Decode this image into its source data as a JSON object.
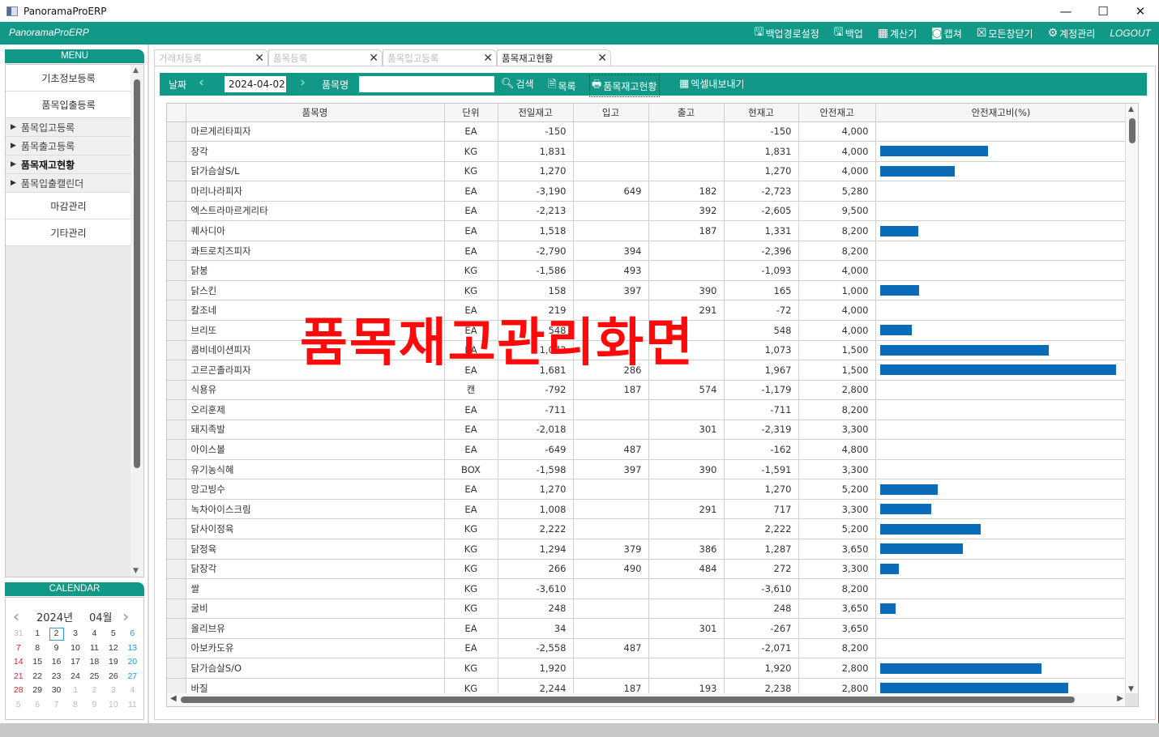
{
  "window": {
    "title": "PanoramaProERP",
    "controls": [
      "—",
      "☐",
      "✕"
    ]
  },
  "appbar": {
    "brand": "PanoramaProERP",
    "actions": [
      {
        "icon": "save-icon",
        "glyph": "🖫",
        "label": "백업경로설정"
      },
      {
        "icon": "save-icon",
        "glyph": "🖫",
        "label": "백업"
      },
      {
        "icon": "calculator-icon",
        "glyph": "▦",
        "label": "계산기"
      },
      {
        "icon": "capture-icon",
        "glyph": "◙",
        "label": "캡쳐"
      },
      {
        "icon": "close-all-icon",
        "glyph": "☒",
        "label": "모든창닫기"
      },
      {
        "icon": "gear-icon",
        "glyph": "⚙",
        "label": "계정관리"
      }
    ],
    "logout": "LOGOUT"
  },
  "sidebar": {
    "menu_title": "MENU",
    "items": [
      {
        "type": "group",
        "label": "기초정보등록"
      },
      {
        "type": "group",
        "label": "품목입출등록"
      },
      {
        "type": "sub",
        "label": "품목입고등록"
      },
      {
        "type": "sub",
        "label": "품목출고등록"
      },
      {
        "type": "sub",
        "label": "품목재고현황",
        "active": true
      },
      {
        "type": "sub",
        "label": "품목입출캘린더"
      },
      {
        "type": "group",
        "label": "마감관리"
      },
      {
        "type": "group",
        "label": "기타관리"
      }
    ],
    "calendar_title": "CALENDAR",
    "calendar": {
      "year": "2024년",
      "month": "04월",
      "selected_day": "2",
      "weeks": [
        [
          "31",
          "1",
          "2",
          "3",
          "4",
          "5",
          "6"
        ],
        [
          "7",
          "8",
          "9",
          "10",
          "11",
          "12",
          "13"
        ],
        [
          "14",
          "15",
          "16",
          "17",
          "18",
          "19",
          "20"
        ],
        [
          "21",
          "22",
          "23",
          "24",
          "25",
          "26",
          "27"
        ],
        [
          "28",
          "29",
          "30",
          "1",
          "2",
          "3",
          "4"
        ],
        [
          "5",
          "6",
          "7",
          "8",
          "9",
          "10",
          "11"
        ]
      ]
    }
  },
  "tabs": [
    {
      "label": "거래처등록",
      "active": false
    },
    {
      "label": "품목등록",
      "active": false
    },
    {
      "label": "품목입고등록",
      "active": false
    },
    {
      "label": "품목재고현황",
      "active": true
    }
  ],
  "toolbar": {
    "date_label": "날짜",
    "date_value": "2024-04-02",
    "item_label": "품목명",
    "item_value": "",
    "search_label": "검색",
    "list_label": "목록",
    "print_label": "품목재고현황",
    "excel_label": "엑셀내보내기"
  },
  "grid": {
    "columns": [
      "품목명",
      "단위",
      "전일재고",
      "입고",
      "출고",
      "현재고",
      "안전재고",
      "안전재고비(%)"
    ],
    "rows": [
      {
        "name": "마르게리타피자",
        "unit": "EA",
        "prev": "-150",
        "in": "",
        "out": "",
        "cur": "-150",
        "safe": "4,000",
        "ratio": 0
      },
      {
        "name": "장각",
        "unit": "KG",
        "prev": "1,831",
        "in": "",
        "out": "",
        "cur": "1,831",
        "safe": "4,000",
        "ratio": 45.8
      },
      {
        "name": "닭가슴살S/L",
        "unit": "KG",
        "prev": "1,270",
        "in": "",
        "out": "",
        "cur": "1,270",
        "safe": "4,000",
        "ratio": 31.8
      },
      {
        "name": "마리나라피자",
        "unit": "EA",
        "prev": "-3,190",
        "in": "649",
        "out": "182",
        "cur": "-2,723",
        "safe": "5,280",
        "ratio": 0
      },
      {
        "name": "엑스트라마르게리타",
        "unit": "EA",
        "prev": "-2,213",
        "in": "",
        "out": "392",
        "cur": "-2,605",
        "safe": "9,500",
        "ratio": 0
      },
      {
        "name": "퀘사디아",
        "unit": "EA",
        "prev": "1,518",
        "in": "",
        "out": "187",
        "cur": "1,331",
        "safe": "8,200",
        "ratio": 16.2
      },
      {
        "name": "콰트로치즈피자",
        "unit": "EA",
        "prev": "-2,790",
        "in": "394",
        "out": "",
        "cur": "-2,396",
        "safe": "8,200",
        "ratio": 0
      },
      {
        "name": "닭봉",
        "unit": "KG",
        "prev": "-1,586",
        "in": "493",
        "out": "",
        "cur": "-1,093",
        "safe": "4,000",
        "ratio": 0
      },
      {
        "name": "닭스킨",
        "unit": "KG",
        "prev": "158",
        "in": "397",
        "out": "390",
        "cur": "165",
        "safe": "1,000",
        "ratio": 16.5
      },
      {
        "name": "칼조네",
        "unit": "EA",
        "prev": "219",
        "in": "",
        "out": "291",
        "cur": "-72",
        "safe": "4,000",
        "ratio": 0
      },
      {
        "name": "브리또",
        "unit": "EA",
        "prev": "548",
        "in": "",
        "out": "",
        "cur": "548",
        "safe": "4,000",
        "ratio": 13.7
      },
      {
        "name": "콤비네이션피자",
        "unit": "EA",
        "prev": "1,073",
        "in": "",
        "out": "",
        "cur": "1,073",
        "safe": "1,500",
        "ratio": 71.5
      },
      {
        "name": "고르곤졸라피자",
        "unit": "EA",
        "prev": "1,681",
        "in": "286",
        "out": "",
        "cur": "1,967",
        "safe": "1,500",
        "ratio": 100
      },
      {
        "name": "식용유",
        "unit": "캔",
        "prev": "-792",
        "in": "187",
        "out": "574",
        "cur": "-1,179",
        "safe": "2,800",
        "ratio": 0
      },
      {
        "name": "오리훈제",
        "unit": "EA",
        "prev": "-711",
        "in": "",
        "out": "",
        "cur": "-711",
        "safe": "8,200",
        "ratio": 0
      },
      {
        "name": "돼지족발",
        "unit": "EA",
        "prev": "-2,018",
        "in": "",
        "out": "301",
        "cur": "-2,319",
        "safe": "3,300",
        "ratio": 0
      },
      {
        "name": "아이스볼",
        "unit": "EA",
        "prev": "-649",
        "in": "487",
        "out": "",
        "cur": "-162",
        "safe": "4,800",
        "ratio": 0
      },
      {
        "name": "유기농식혜",
        "unit": "BOX",
        "prev": "-1,598",
        "in": "397",
        "out": "390",
        "cur": "-1,591",
        "safe": "3,300",
        "ratio": 0
      },
      {
        "name": "망고빙수",
        "unit": "EA",
        "prev": "1,270",
        "in": "",
        "out": "",
        "cur": "1,270",
        "safe": "5,200",
        "ratio": 24.4
      },
      {
        "name": "녹차아이스크림",
        "unit": "EA",
        "prev": "1,008",
        "in": "",
        "out": "291",
        "cur": "717",
        "safe": "3,300",
        "ratio": 21.7
      },
      {
        "name": "닭사이정육",
        "unit": "KG",
        "prev": "2,222",
        "in": "",
        "out": "",
        "cur": "2,222",
        "safe": "5,200",
        "ratio": 42.7
      },
      {
        "name": "닭정육",
        "unit": "KG",
        "prev": "1,294",
        "in": "379",
        "out": "386",
        "cur": "1,287",
        "safe": "3,650",
        "ratio": 35.3
      },
      {
        "name": "닭장각",
        "unit": "KG",
        "prev": "266",
        "in": "490",
        "out": "484",
        "cur": "272",
        "safe": "3,300",
        "ratio": 8.2
      },
      {
        "name": "쌀",
        "unit": "KG",
        "prev": "-3,610",
        "in": "",
        "out": "",
        "cur": "-3,610",
        "safe": "8,200",
        "ratio": 0
      },
      {
        "name": "굴비",
        "unit": "KG",
        "prev": "248",
        "in": "",
        "out": "",
        "cur": "248",
        "safe": "3,650",
        "ratio": 6.8
      },
      {
        "name": "올리브유",
        "unit": "EA",
        "prev": "34",
        "in": "",
        "out": "301",
        "cur": "-267",
        "safe": "3,650",
        "ratio": 0
      },
      {
        "name": "아보카도유",
        "unit": "EA",
        "prev": "-2,558",
        "in": "487",
        "out": "",
        "cur": "-2,071",
        "safe": "8,200",
        "ratio": 0
      },
      {
        "name": "닭가슴살S/O",
        "unit": "KG",
        "prev": "1,920",
        "in": "",
        "out": "",
        "cur": "1,920",
        "safe": "2,800",
        "ratio": 68.6
      },
      {
        "name": "바질",
        "unit": "KG",
        "prev": "2,244",
        "in": "187",
        "out": "193",
        "cur": "2,238",
        "safe": "2,800",
        "ratio": 79.9
      }
    ]
  },
  "overlay": {
    "watermark": "품목재고관리화면"
  },
  "colors": {
    "accent": "#119886",
    "bar": "#0a6cb8",
    "watermark": "#ff0a0a",
    "sunday": "#e0222e",
    "saturday": "#1aa0d8"
  }
}
